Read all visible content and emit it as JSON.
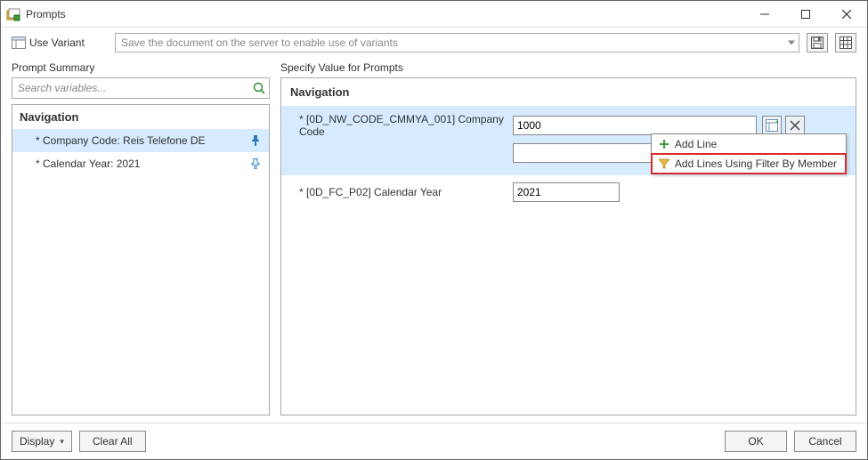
{
  "window": {
    "title": "Prompts"
  },
  "variant": {
    "label": "Use Variant",
    "placeholder": "Save the document on the server to enable use of variants"
  },
  "left": {
    "header": "Prompt Summary",
    "search_placeholder": "Search variables...",
    "nav_header": "Navigation",
    "items": [
      {
        "label": "* Company Code: Reis Telefone DE",
        "selected": true
      },
      {
        "label": "* Calendar Year: 2021",
        "selected": false
      }
    ]
  },
  "right": {
    "header": "Specify Value for Prompts",
    "section": "Navigation",
    "prompts": [
      {
        "label": "* [0D_NW_CODE_CMMYA_001] Company Code",
        "value": "1000",
        "highlight": true,
        "extra_empty_row": true
      },
      {
        "label": "* [0D_FC_P02] Calendar Year",
        "value": "2021",
        "highlight": false,
        "extra_empty_row": false
      }
    ],
    "dropdown": {
      "add_line": "Add Line",
      "filter_member": "Add Lines Using Filter By Member"
    }
  },
  "footer": {
    "display": "Display",
    "clear_all": "Clear All",
    "ok": "OK",
    "cancel": "Cancel"
  }
}
